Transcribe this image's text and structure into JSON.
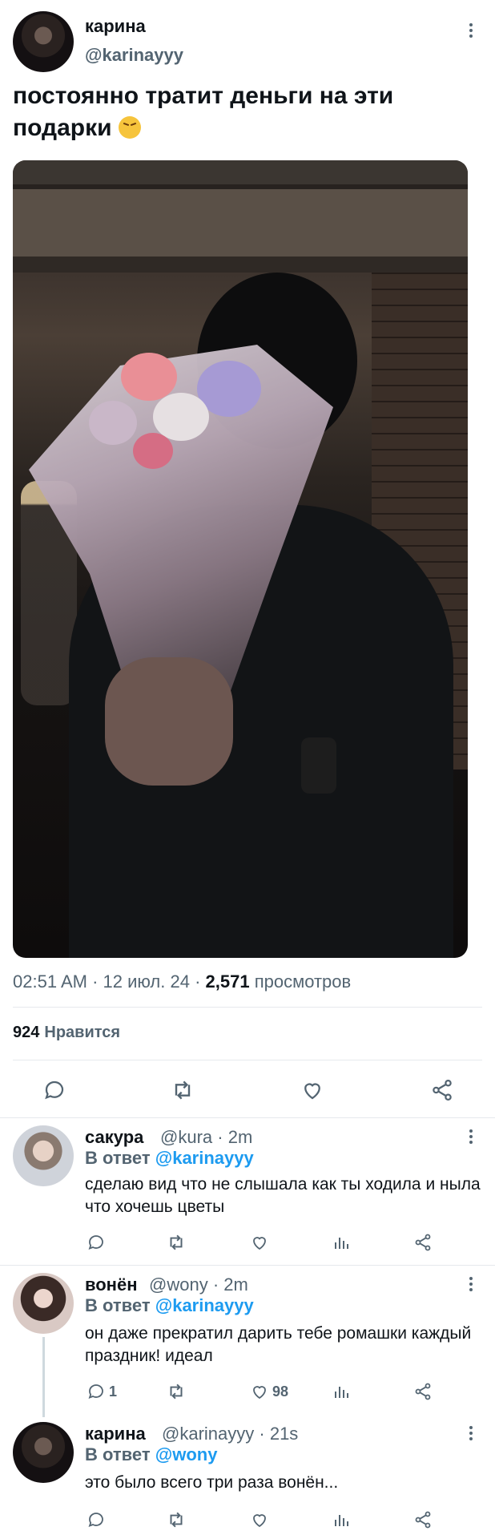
{
  "main_tweet": {
    "author_name": "карина",
    "author_handle": "@karinayyy",
    "text": "постоянно тратит деньги на эти подарки",
    "emoji": "weary-face",
    "time": "02:51 AM",
    "date": "12 июл. 24",
    "views_count": "2,571",
    "views_label": "просмотров",
    "likes_count": "924",
    "likes_label": "Нравится"
  },
  "replies": [
    {
      "name": "сакура",
      "handle": "@kura",
      "age": "2m",
      "reply_prefix": "В ответ",
      "reply_to": "@karinayyy",
      "text": "сделаю вид что не слышала как ты ходила и ныла что хочешь цветы",
      "reply_count": "",
      "like_count": ""
    },
    {
      "name": "вонён",
      "handle": "@wony",
      "age": "2m",
      "reply_prefix": "В ответ",
      "reply_to": "@karinayyy",
      "text": "он даже прекратил дарить тебе ромашки каждый праздник! идеал",
      "reply_count": "1",
      "like_count": "98"
    },
    {
      "name": "карина",
      "handle": "@karinayyy",
      "age": "21s",
      "reply_prefix": "В ответ",
      "reply_to": "@wony",
      "text": "это было всего три раза вонён...",
      "reply_count": "",
      "like_count": ""
    }
  ],
  "colors": {
    "text": "#0f1419",
    "secondary": "#536471",
    "accent": "#1d9bf0",
    "divider": "#e6e9ed"
  },
  "icons": {
    "reply": "reply-icon",
    "retweet": "retweet-icon",
    "like": "heart-icon",
    "share": "share-icon",
    "views": "views-icon",
    "more": "more-icon"
  }
}
